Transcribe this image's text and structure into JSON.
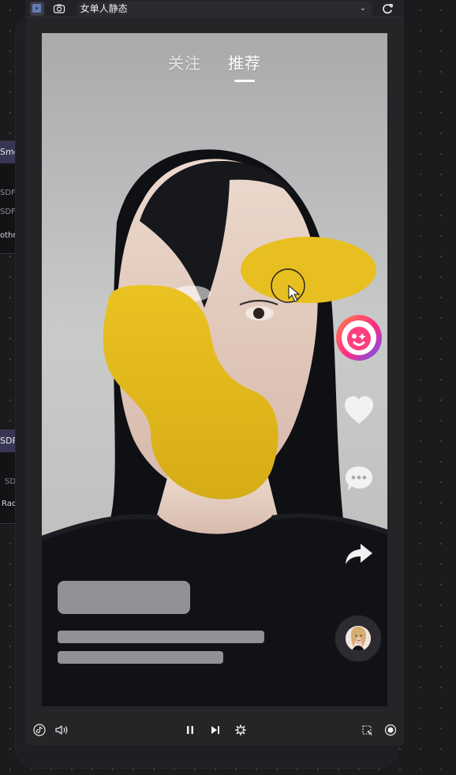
{
  "window": {
    "selected_scene": "女单人静态"
  },
  "left_panels": [
    {
      "title": "Smooth",
      "rows": [
        {
          "label": "S"
        },
        {
          "label": "SDF"
        },
        {
          "label": "SDF"
        },
        {
          "label": "othnes"
        }
      ]
    },
    {
      "title": "SDF A",
      "rows": [
        {
          "label": "SDF"
        },
        {
          "label": "Radiu"
        }
      ]
    }
  ],
  "app": {
    "tabs": [
      "关注",
      "推荐"
    ],
    "active_tab": "推荐"
  },
  "icons": {
    "topbar_left_1": "layers-toggle-icon",
    "topbar_left_2": "camera-icon",
    "topbar_right": "refresh-icon",
    "bottom_left_1": "tiktok-logo-icon",
    "bottom_left_2": "speaker-icon",
    "bottom_center_1": "pause-icon",
    "bottom_center_2": "step-forward-icon",
    "bottom_center_3": "effect-sparkle-icon",
    "bottom_right_1": "crop-screen-icon",
    "bottom_right_2": "record-icon",
    "action_1": "effect-sticker-icon",
    "action_2": "heart-icon",
    "action_3": "comment-icon",
    "action_4": "share-icon"
  },
  "colors": {
    "blob": "#e9bf22",
    "tab_active": "#ffffff",
    "tab_inactive": "#f1f1f1",
    "placeholder": "#9d9da1"
  }
}
